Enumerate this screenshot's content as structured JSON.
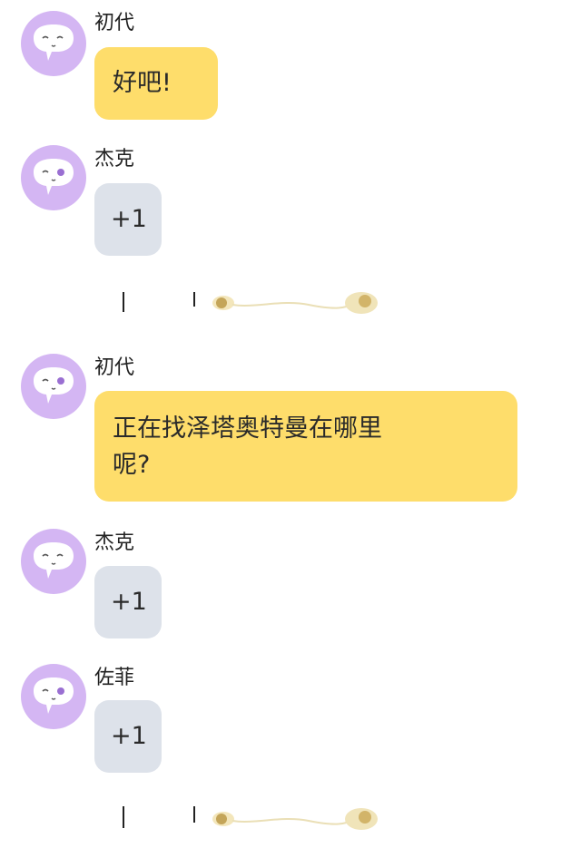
{
  "messages": [
    {
      "sender": "初代",
      "text": "好吧!",
      "style": "yellow"
    },
    {
      "sender": "杰克",
      "text": "+1",
      "style": "gray"
    },
    {
      "sender": "初代",
      "text": "正在找泽塔奥特曼在哪里\n呢?",
      "style": "yellow"
    },
    {
      "sender": "杰克",
      "text": "+1",
      "style": "gray"
    },
    {
      "sender": "佐菲",
      "text": "+1",
      "style": "gray"
    }
  ],
  "colors": {
    "avatar": "#d4b6f3",
    "yellow_bubble": "#fedd6b",
    "gray_bubble": "#dde2ea"
  },
  "icons": {
    "avatar": "chat-bubble-face-icon",
    "divider": "snail-ornament-divider-icon"
  }
}
